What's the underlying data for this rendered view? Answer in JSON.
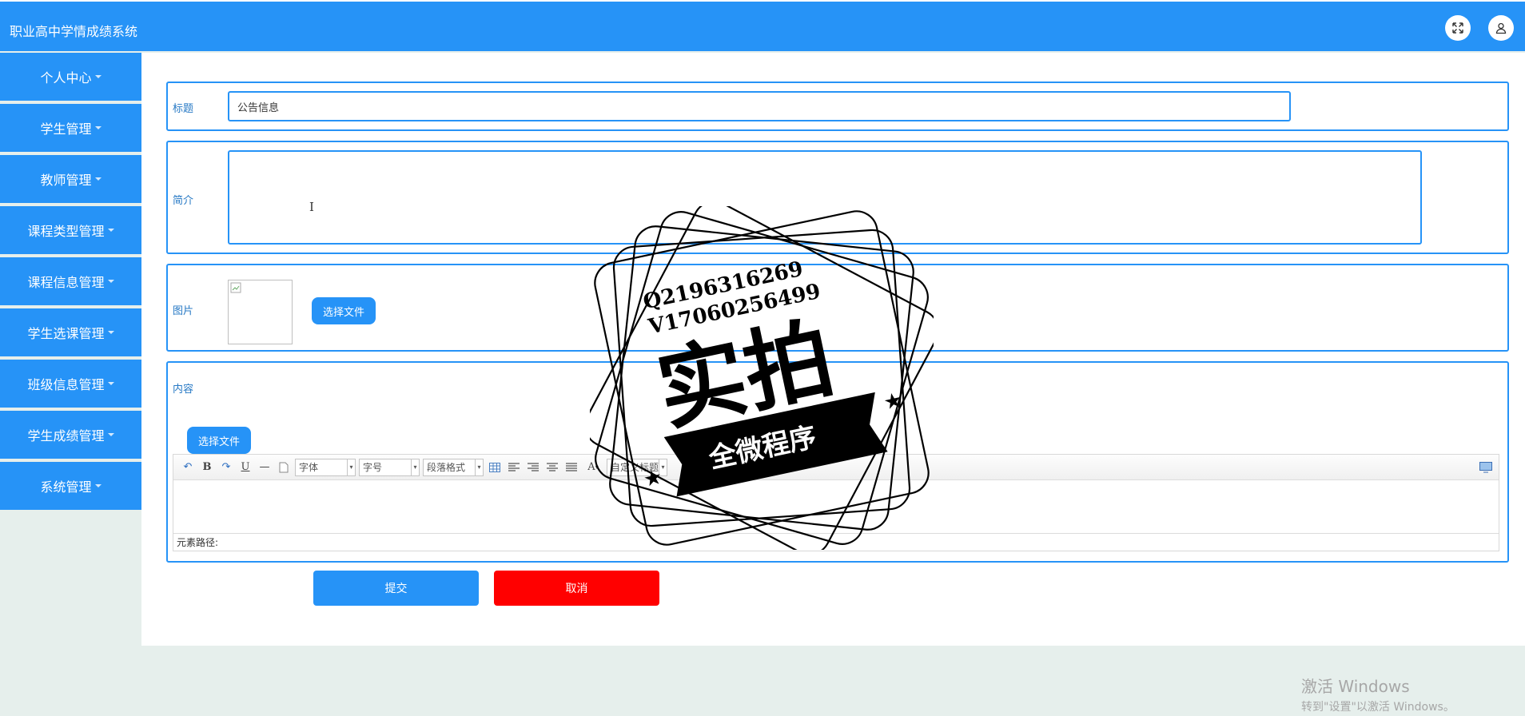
{
  "header": {
    "app_title": "职业高中学情成绩系统",
    "fullscreen_icon": "expand-icon",
    "user_icon": "user-icon"
  },
  "sidebar": {
    "items": [
      {
        "label": "个人中心"
      },
      {
        "label": "学生管理"
      },
      {
        "label": "教师管理"
      },
      {
        "label": "课程类型管理"
      },
      {
        "label": "课程信息管理"
      },
      {
        "label": "学生选课管理"
      },
      {
        "label": "班级信息管理"
      },
      {
        "label": "学生成绩管理"
      },
      {
        "label": "系统管理"
      }
    ]
  },
  "form": {
    "title_label": "标题",
    "title_value": "公告信息",
    "intro_label": "简介",
    "intro_value": "",
    "image_label": "图片",
    "image_choose": "选择文件",
    "content_label": "内容",
    "content_choose": "选择文件",
    "editor": {
      "font_select": "字体",
      "size_select": "字号",
      "paragraph_select": "段落格式",
      "custom_title_select": "自定义标题",
      "status_text": "元素路径:"
    },
    "submit_label": "提交",
    "cancel_label": "取消"
  },
  "watermark": {
    "line1": "Q2196316269",
    "line2": "V17060256499",
    "main": "实拍",
    "banner": "全微程序"
  },
  "windows_activation": {
    "line1": "激活 Windows",
    "line2": "转到\"设置\"以激活 Windows。"
  },
  "colors": {
    "primary": "#2693f7",
    "danger": "#ff0000",
    "page_bg": "#e6efec"
  }
}
